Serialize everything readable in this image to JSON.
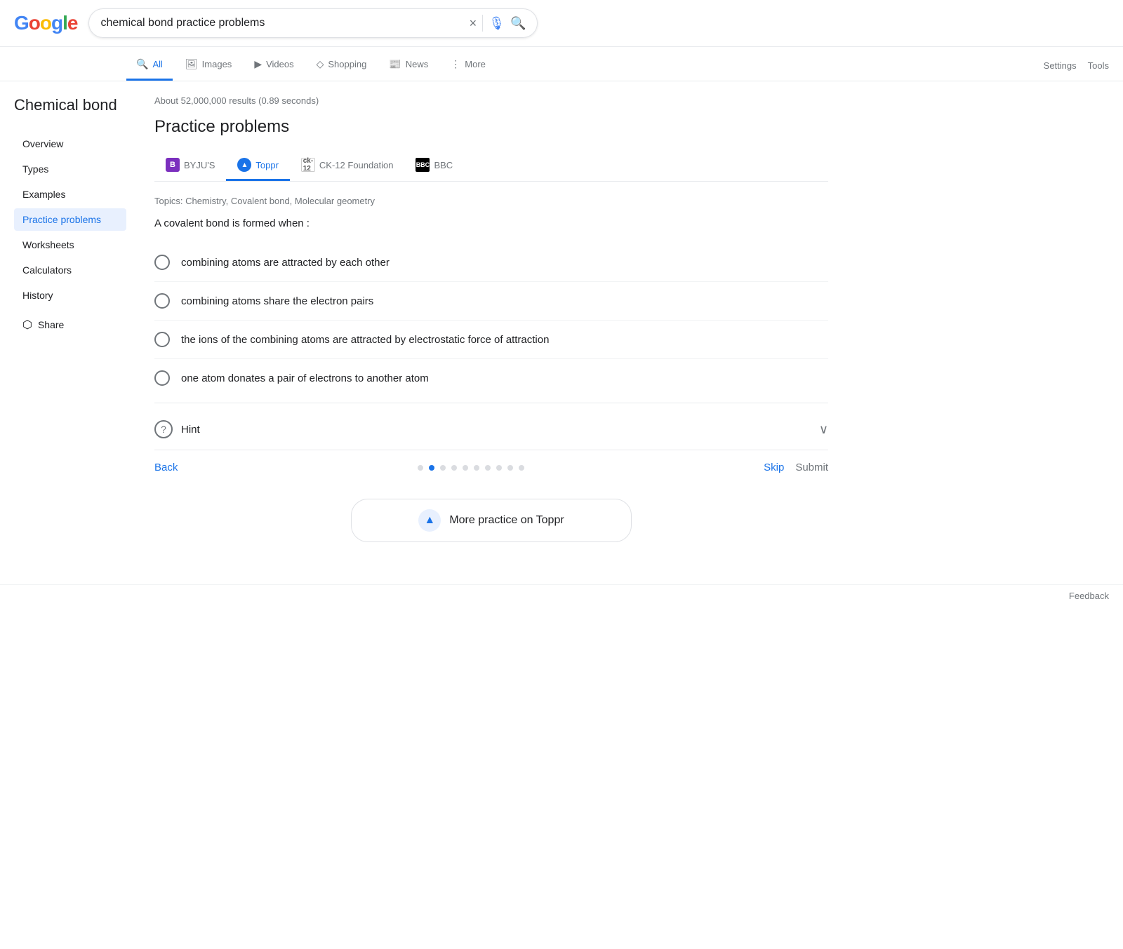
{
  "header": {
    "search_query": "chemical bond practice problems",
    "clear_label": "×",
    "search_button_label": "🔍"
  },
  "nav": {
    "tabs": [
      {
        "id": "all",
        "label": "All",
        "icon": "🔍",
        "active": true
      },
      {
        "id": "images",
        "label": "Images",
        "icon": "🖼"
      },
      {
        "id": "videos",
        "label": "Videos",
        "icon": "▶"
      },
      {
        "id": "shopping",
        "label": "Shopping",
        "icon": "◇"
      },
      {
        "id": "news",
        "label": "News",
        "icon": "📰"
      },
      {
        "id": "more",
        "label": "More",
        "icon": "⋮"
      }
    ],
    "settings_label": "Settings",
    "tools_label": "Tools"
  },
  "sidebar": {
    "title": "Chemical bond",
    "items": [
      {
        "id": "overview",
        "label": "Overview",
        "active": false
      },
      {
        "id": "types",
        "label": "Types",
        "active": false
      },
      {
        "id": "examples",
        "label": "Examples",
        "active": false
      },
      {
        "id": "practice",
        "label": "Practice problems",
        "active": true
      },
      {
        "id": "worksheets",
        "label": "Worksheets",
        "active": false
      },
      {
        "id": "calculators",
        "label": "Calculators",
        "active": false
      },
      {
        "id": "history",
        "label": "History",
        "active": false
      }
    ],
    "share_label": "Share"
  },
  "results": {
    "info": "About 52,000,000 results (0.89 seconds)",
    "section_title": "Practice problems",
    "sources": [
      {
        "id": "byjus",
        "label": "BYJU'S",
        "logo_type": "byju"
      },
      {
        "id": "toppr",
        "label": "Toppr",
        "logo_type": "toppr",
        "active": true
      },
      {
        "id": "ck12",
        "label": "CK-12 Foundation",
        "logo_type": "ck12"
      },
      {
        "id": "bbc",
        "label": "BBC",
        "logo_type": "bbc"
      }
    ],
    "topics": "Topics: Chemistry, Covalent bond, Molecular geometry",
    "question": "A covalent bond is formed when :",
    "options": [
      {
        "id": "a",
        "text": "combining atoms are attracted by each other"
      },
      {
        "id": "b",
        "text": "combining atoms share the electron pairs"
      },
      {
        "id": "c",
        "text": "the ions of the combining atoms are attracted by electrostatic force of attraction"
      },
      {
        "id": "d",
        "text": "one atom donates a pair of electrons to another atom"
      }
    ],
    "hint_label": "Hint",
    "nav": {
      "back_label": "Back",
      "dots_count": 10,
      "active_dot": 1,
      "skip_label": "Skip",
      "submit_label": "Submit"
    },
    "more_practice_label": "More practice on Toppr"
  },
  "feedback": {
    "label": "Feedback"
  }
}
